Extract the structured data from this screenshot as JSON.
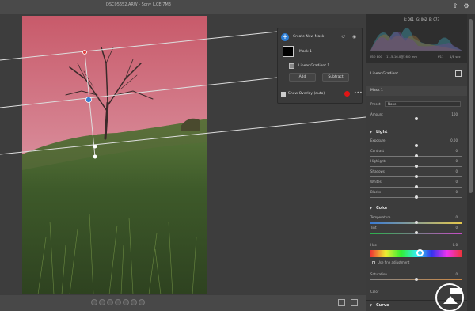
{
  "window": {
    "title": "DSC05652.ARW  -  Sony ILCE-7M3"
  },
  "top_icons": [
    "share-icon",
    "gear-icon"
  ],
  "mask_panel": {
    "create_label": "Create New Mask",
    "mask_name": "Mask 1",
    "gradient_name": "Linear Gradient 1",
    "add_label": "Add",
    "subtract_label": "Subtract",
    "overlay_label": "Show Overlay (auto)",
    "overlay_color": "#e01515"
  },
  "histogram": {
    "readout": [
      "R: 061",
      "G: 062",
      "B: 073"
    ],
    "camera": [
      "ISO 800",
      "11.5-16.0@16.0 mm",
      "f/11",
      "1/8 sec"
    ]
  },
  "right_panel": {
    "tool_title": "Linear Gradient",
    "mask_label": "Mask 1",
    "preset_label": "Preset",
    "preset_value": "None",
    "amount_label": "Amount",
    "amount_value": "100",
    "light": {
      "title": "Light",
      "sliders": [
        {
          "label": "Exposure",
          "value": "0.00",
          "pos": 0.5
        },
        {
          "label": "Contrast",
          "value": "0",
          "pos": 0.5
        },
        {
          "label": "Highlights",
          "value": "0",
          "pos": 0.5
        },
        {
          "label": "Shadows",
          "value": "0",
          "pos": 0.5
        },
        {
          "label": "Whites",
          "value": "0",
          "pos": 0.5
        },
        {
          "label": "Blacks",
          "value": "0",
          "pos": 0.5
        }
      ]
    },
    "color": {
      "title": "Color",
      "temperature_label": "Temperature",
      "temperature_value": "0",
      "tint_label": "Tint",
      "tint_value": "0",
      "hue_label": "Hue",
      "hue_value": "0.0",
      "fine_label": "Use fine adjustment",
      "saturation_label": "Saturation",
      "saturation_value": "0",
      "color_label": "Color"
    },
    "curve_title": "Curve"
  },
  "watermark": {
    "text": "PHOTOGRAPHY"
  }
}
